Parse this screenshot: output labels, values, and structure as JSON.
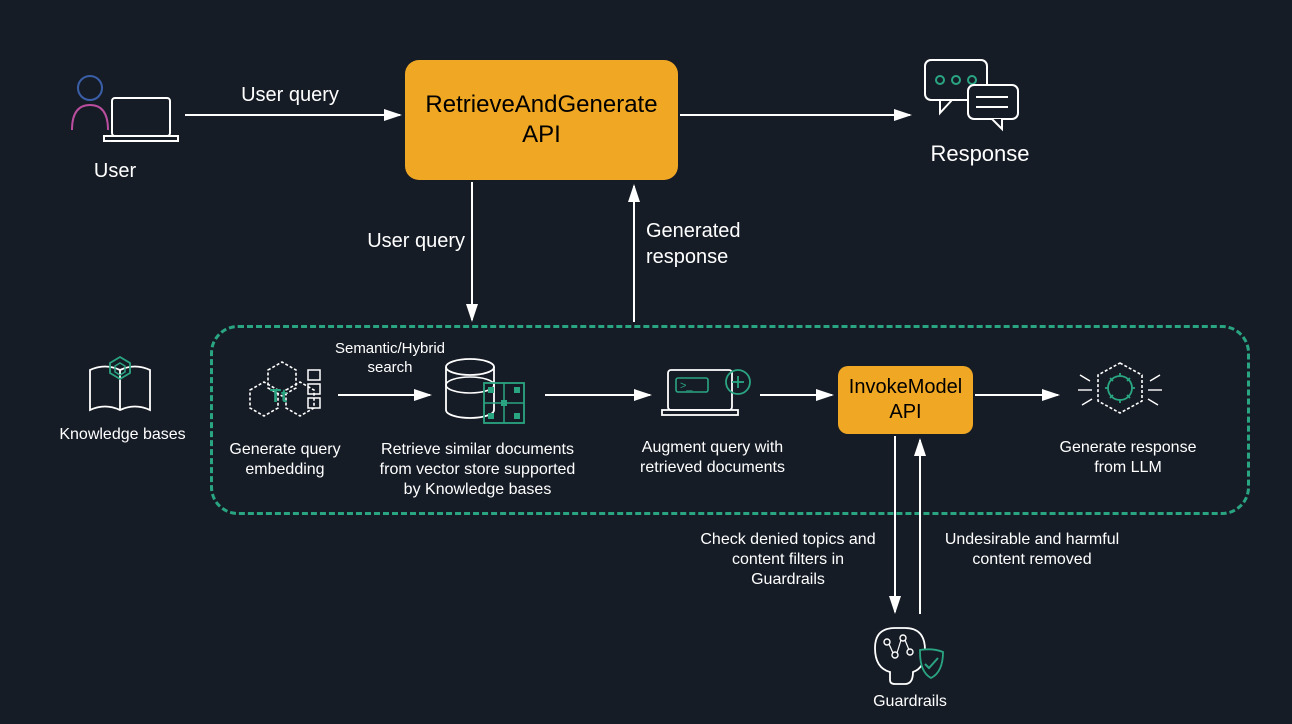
{
  "nodes": {
    "user": {
      "label": "User"
    },
    "retrieve_api": {
      "line1": "RetrieveAndGenerate",
      "line2": "API"
    },
    "response": {
      "label": "Response"
    },
    "knowledge_bases": {
      "label": "Knowledge bases"
    },
    "query_embedding": {
      "line1": "Generate query",
      "line2": "embedding"
    },
    "retrieve_docs": {
      "line1": "Retrieve similar documents",
      "line2": "from vector store supported",
      "line3": "by Knowledge bases"
    },
    "augment": {
      "line1": "Augment query with",
      "line2": "retrieved documents"
    },
    "invoke_api": {
      "line1": "InvokeModel",
      "line2": "API"
    },
    "generate_llm": {
      "line1": "Generate response",
      "line2": "from LLM"
    },
    "guardrails": {
      "label": "Guardrails"
    }
  },
  "edges": {
    "user_query_top": "User query",
    "user_query_down": "User query",
    "generated_response": {
      "line1": "Generated",
      "line2": "response"
    },
    "semantic_search": {
      "line1": "Semantic/Hybrid",
      "line2": "search"
    },
    "check_guardrails": {
      "line1": "Check denied topics and",
      "line2": "content filters in",
      "line3": "Guardrails"
    },
    "undesirable_removed": {
      "line1": "Undesirable and harmful",
      "line2": "content removed"
    }
  },
  "colors": {
    "bg": "#161c26",
    "accent_orange": "#f0a724",
    "accent_teal": "#2aa582",
    "white": "#ffffff"
  }
}
